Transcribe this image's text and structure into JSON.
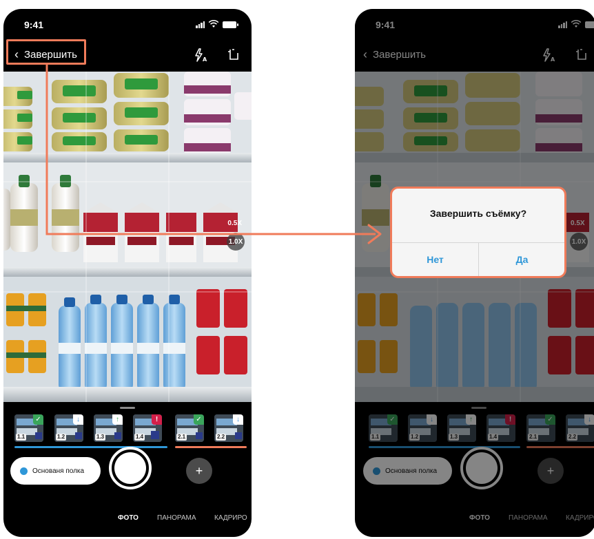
{
  "colors": {
    "accent": "#f07b5a",
    "link_blue": "#2f97d8",
    "badge_ok": "#3aa55b",
    "badge_alert": "#d3204a",
    "group1_underline": "#2f97d8",
    "group2_underline": "#f07b5a"
  },
  "status": {
    "time": "9:41"
  },
  "nav": {
    "back_label": "Завершить",
    "flash_icon": "flash-auto-icon",
    "crop_icon": "crop-frame-icon"
  },
  "viewfinder": {
    "zoom_secondary": "0.5X",
    "zoom_current": "1.0X"
  },
  "thumbnails": [
    {
      "label": "1.1",
      "badge": "✓",
      "state": "ok"
    },
    {
      "label": "1.2",
      "badge": "↓",
      "state": "down"
    },
    {
      "label": "1.3",
      "badge": "↑",
      "state": "up"
    },
    {
      "label": "1.4",
      "badge": "!",
      "state": "alert"
    },
    {
      "label": "2.1",
      "badge": "✓",
      "state": "ok"
    },
    {
      "label": "2.2",
      "badge": "↓",
      "state": "down"
    }
  ],
  "controls": {
    "shelf_label": "Основаня полка",
    "add_symbol": "+"
  },
  "modes": [
    "ФОТО",
    "ПАНОРАМА",
    "КАДРИРО"
  ],
  "dialog": {
    "title": "Завершить съёмку?",
    "no_label": "Нет",
    "yes_label": "Да"
  }
}
